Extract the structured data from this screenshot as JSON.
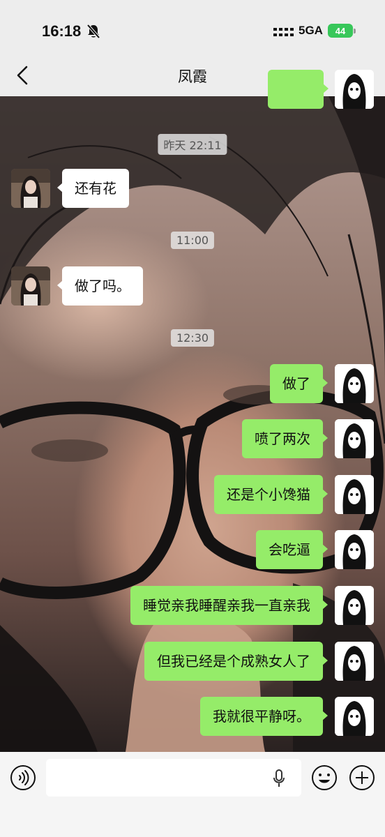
{
  "status_bar": {
    "time": "16:18",
    "network": "5GA",
    "battery": "44"
  },
  "nav": {
    "title": "凤霞"
  },
  "messages": [
    {
      "type": "timestamp",
      "text": "昨天 22:11"
    },
    {
      "type": "incoming",
      "text": "还有花"
    },
    {
      "type": "timestamp",
      "text": "11:00"
    },
    {
      "type": "incoming",
      "text": "做了吗。"
    },
    {
      "type": "timestamp",
      "text": "12:30"
    },
    {
      "type": "outgoing",
      "text": "做了"
    },
    {
      "type": "outgoing",
      "text": "喷了两次"
    },
    {
      "type": "outgoing",
      "text": "还是个小馋猫"
    },
    {
      "type": "outgoing",
      "text": "会吃逼"
    },
    {
      "type": "outgoing",
      "text": "睡觉亲我睡醒亲我一直亲我"
    },
    {
      "type": "outgoing",
      "text": "但我已经是个成熟女人了"
    },
    {
      "type": "outgoing",
      "text": "我就很平静呀。"
    }
  ],
  "colors": {
    "outgoing_bubble": "#95ec69",
    "incoming_bubble": "#ffffff",
    "bar_background": "#ededed"
  },
  "icons": {
    "status": [
      "bell-muted-icon",
      "signal-icon",
      "battery-icon"
    ],
    "nav": [
      "back-arrow-icon",
      "more-dots-icon"
    ],
    "input": [
      "voice-icon",
      "mic-icon",
      "emoji-icon",
      "plus-icon"
    ]
  }
}
